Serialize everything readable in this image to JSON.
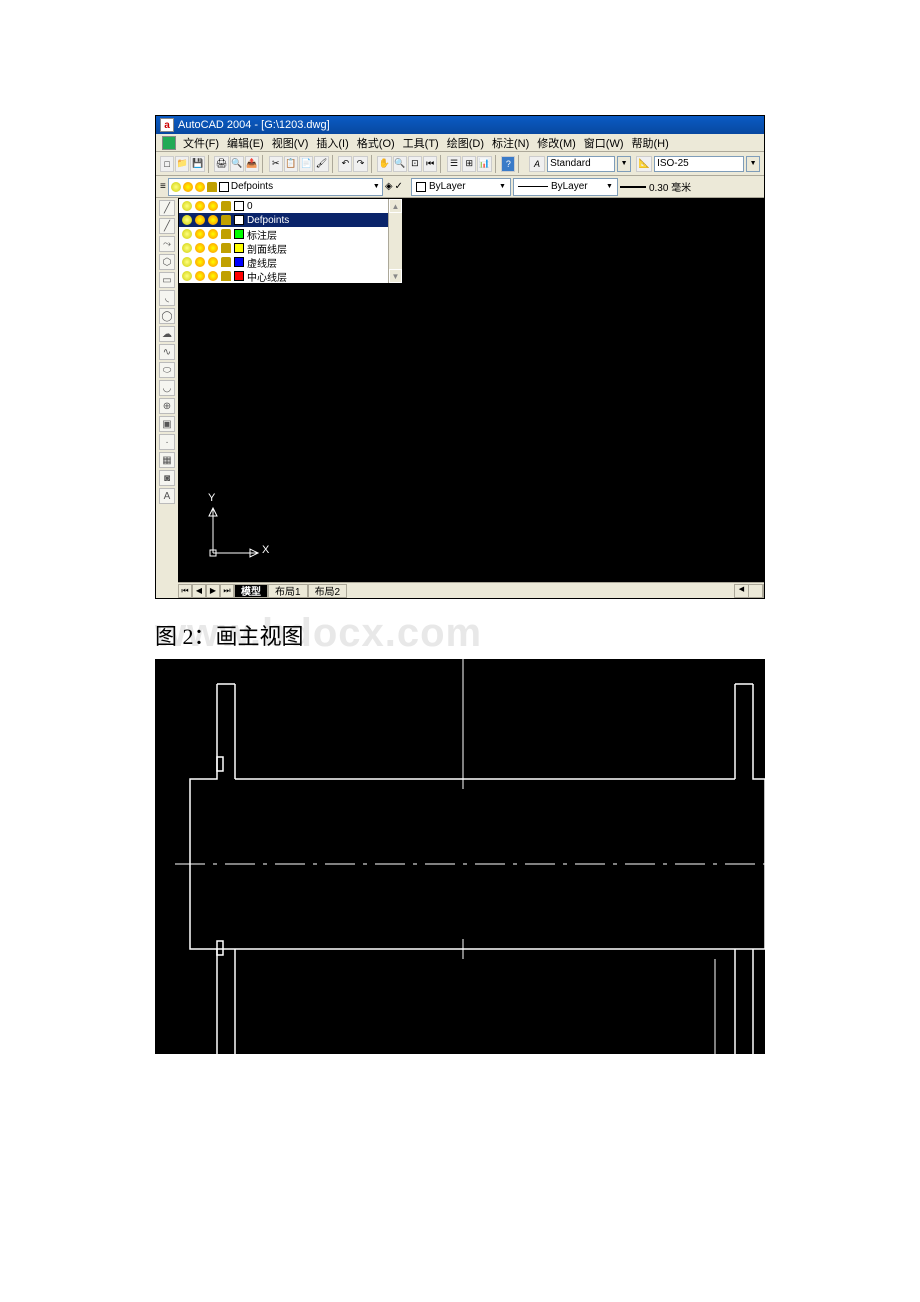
{
  "titlebar": {
    "app_icon": "a",
    "title": "AutoCAD 2004 - [G:\\1203.dwg]"
  },
  "menubar": {
    "items": [
      "文件(F)",
      "编辑(E)",
      "视图(V)",
      "插入(I)",
      "格式(O)",
      "工具(T)",
      "绘图(D)",
      "标注(N)",
      "修改(M)",
      "窗口(W)",
      "帮助(H)"
    ]
  },
  "toolbar": {
    "text_style": "Standard",
    "dim_style": "ISO-25"
  },
  "layer_row": {
    "current_layer": "Defpoints",
    "color_name": "ByLayer",
    "linetype": "ByLayer",
    "lineweight": "0.30 毫米"
  },
  "layer_dropdown": {
    "items": [
      {
        "name": "0",
        "color": "sw-white",
        "selected": false
      },
      {
        "name": "Defpoints",
        "color": "sw-white",
        "selected": true
      },
      {
        "name": "标注层",
        "color": "sw-green",
        "selected": false
      },
      {
        "name": "剖面线层",
        "color": "sw-yellow",
        "selected": false
      },
      {
        "name": "虚线层",
        "color": "sw-blue",
        "selected": false
      },
      {
        "name": "中心线层",
        "color": "sw-red",
        "selected": false
      }
    ]
  },
  "ucs": {
    "x": "X",
    "y": "Y"
  },
  "tabs": {
    "items": [
      {
        "label": "模型",
        "active": true
      },
      {
        "label": "布局1",
        "active": false
      },
      {
        "label": "布局2",
        "active": false
      }
    ]
  },
  "caption": "图 2：画主视图",
  "watermark": "www.bdocx.com"
}
